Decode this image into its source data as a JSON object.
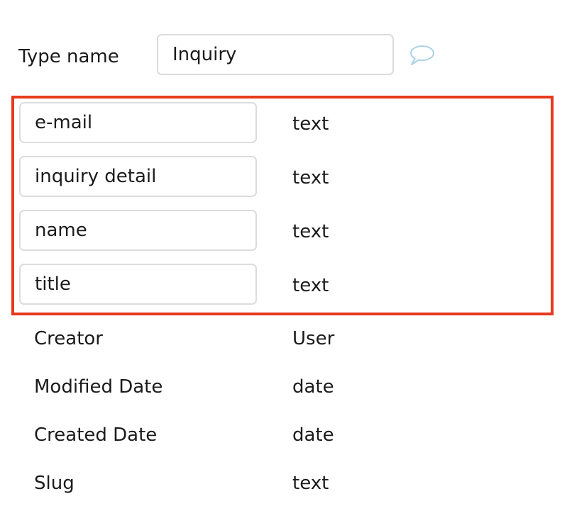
{
  "type_editor": {
    "label": "Type name",
    "value": "Inquiry",
    "comment_icon": "speech-bubble-icon"
  },
  "custom_fields": [
    {
      "name": "e-mail",
      "type": "text"
    },
    {
      "name": "inquiry detail",
      "type": "text"
    },
    {
      "name": "name",
      "type": "text"
    },
    {
      "name": "title",
      "type": "text"
    }
  ],
  "builtin_fields": [
    {
      "name": "Creator",
      "type": "User"
    },
    {
      "name": "Modified Date",
      "type": "date"
    },
    {
      "name": "Created Date",
      "type": "date"
    },
    {
      "name": "Slug",
      "type": "text"
    }
  ],
  "colors": {
    "highlight": "#e8391e",
    "input_border": "#dcdcdc",
    "icon_stroke": "#a9d3e6"
  }
}
